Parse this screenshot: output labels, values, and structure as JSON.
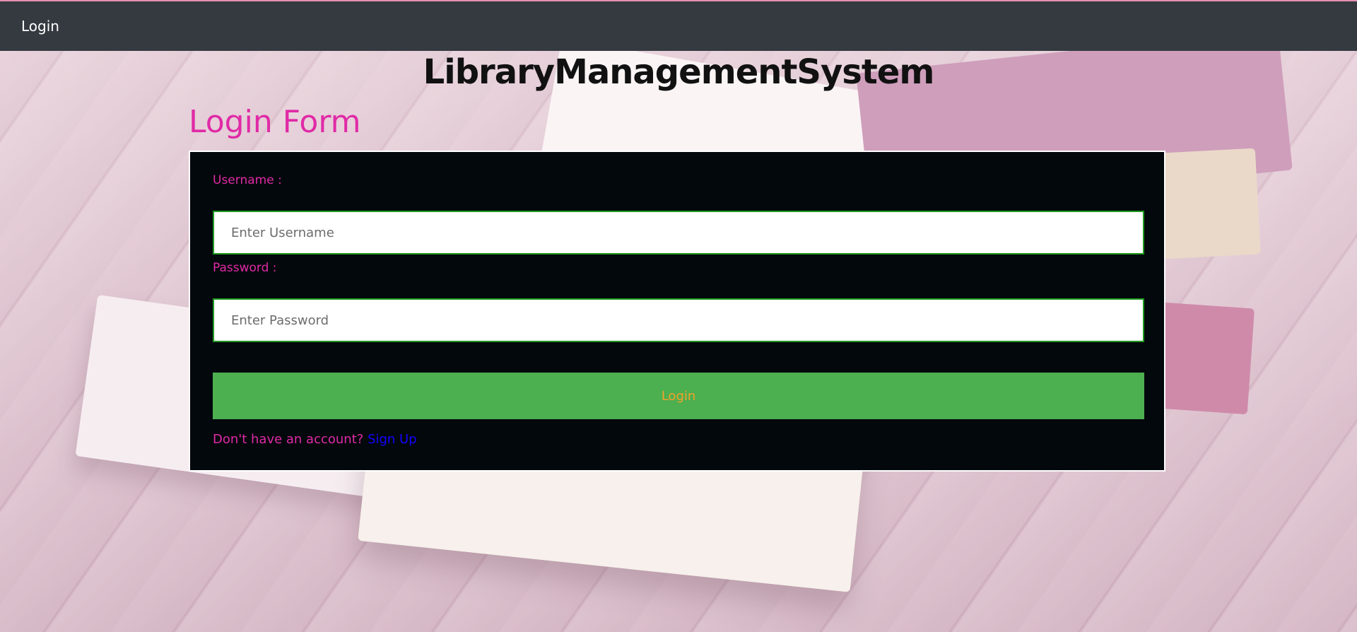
{
  "navbar": {
    "brand_link": "Login"
  },
  "header": {
    "site_title": "LibraryManagementSystem"
  },
  "form": {
    "heading": "Login Form",
    "username_label": "Username :",
    "username_placeholder": "Enter Username",
    "username_value": "",
    "password_label": "Password :",
    "password_placeholder": "Enter Password",
    "password_value": "",
    "submit_label": "Login",
    "signup_prompt": "Don't have an account?",
    "signup_link": "Sign Up"
  },
  "colors": {
    "navbar_bg": "#343a40",
    "accent_pink": "#e02aa6",
    "panel_bg": "#03080c",
    "button_bg": "#4caf50",
    "button_text": "#f2a12b",
    "link_blue": "#1400ff",
    "input_border": "#1f9a1f"
  }
}
